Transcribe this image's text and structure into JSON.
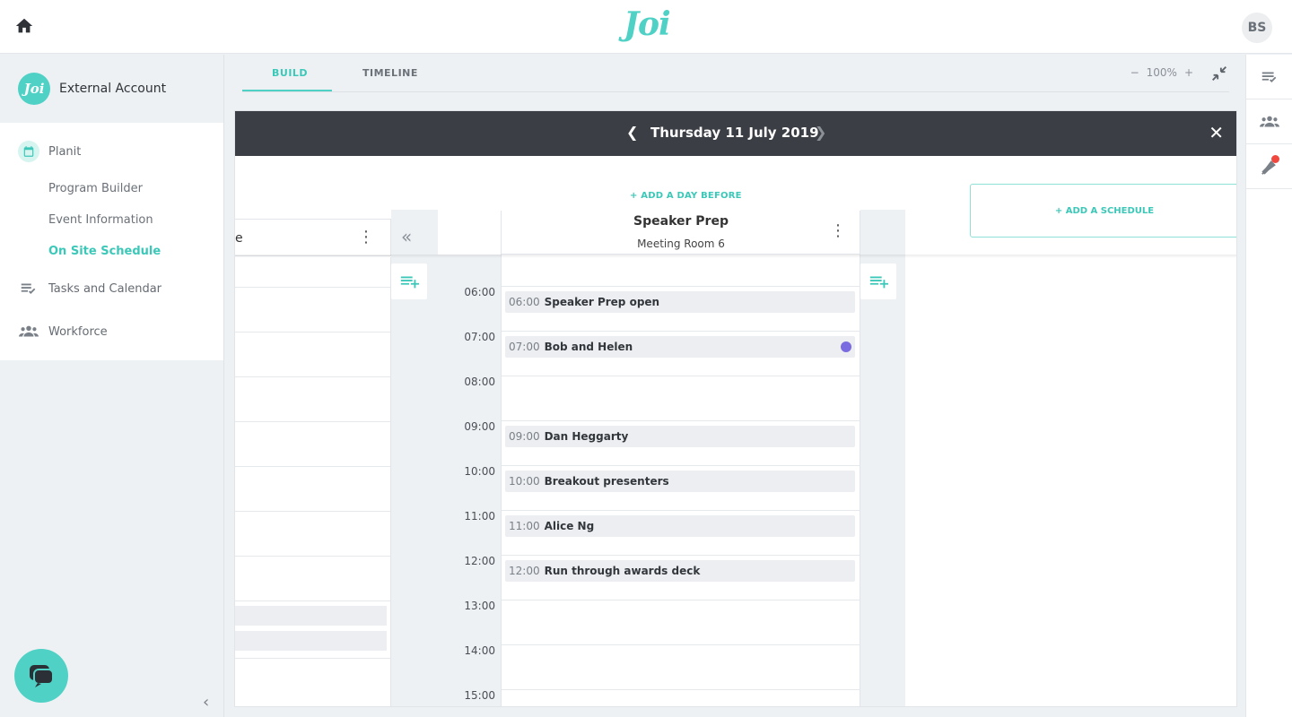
{
  "app": {
    "logo": "Joi"
  },
  "user": {
    "initials": "BS"
  },
  "account": {
    "logo": "Joi",
    "name": "External Account"
  },
  "nav": {
    "planit": "Planit",
    "sub": [
      "Program Builder",
      "Event Information",
      "On Site Schedule"
    ],
    "tasks": "Tasks and Calendar",
    "workforce": "Workforce"
  },
  "tabs": {
    "build": "BUILD",
    "timeline": "TIMELINE"
  },
  "zoom": {
    "minus": "−",
    "value": "100%",
    "plus": "+"
  },
  "schedule": {
    "date": "Thursday 11 July 2019",
    "add_day_before": "+ ADD A DAY BEFORE",
    "add_schedule": "+ ADD A SCHEDULE",
    "left_column_title": "e",
    "column": {
      "title": "Speaker Prep",
      "subtitle": "Meeting Room 6"
    },
    "times": [
      "06:00",
      "07:00",
      "08:00",
      "09:00",
      "10:00",
      "11:00",
      "12:00",
      "13:00",
      "14:00",
      "15:00"
    ],
    "events": [
      {
        "time": "06:00",
        "name": "Speaker Prep open"
      },
      {
        "time": "07:00",
        "name": "Bob and Helen"
      },
      {
        "time": "09:00",
        "name": "Dan Heggarty"
      },
      {
        "time": "10:00",
        "name": "Breakout presenters"
      },
      {
        "time": "11:00",
        "name": "Alice Ng"
      },
      {
        "time": "12:00",
        "name": "Run through awards deck"
      }
    ]
  },
  "colors": {
    "accent": "#4fd1c5",
    "header": "#3b3f45",
    "event_dot": "#7b6be0",
    "notification": "#f0483e"
  },
  "icons": [
    "home-icon",
    "calendar-icon",
    "tasks-icon",
    "people-icon",
    "chat-icon",
    "chevron-left-icon",
    "chevron-right-icon",
    "close-icon",
    "kebab-menu-icon",
    "double-chevron-left-icon",
    "playlist-add-icon",
    "exit-fullscreen-icon",
    "bell-icon"
  ]
}
